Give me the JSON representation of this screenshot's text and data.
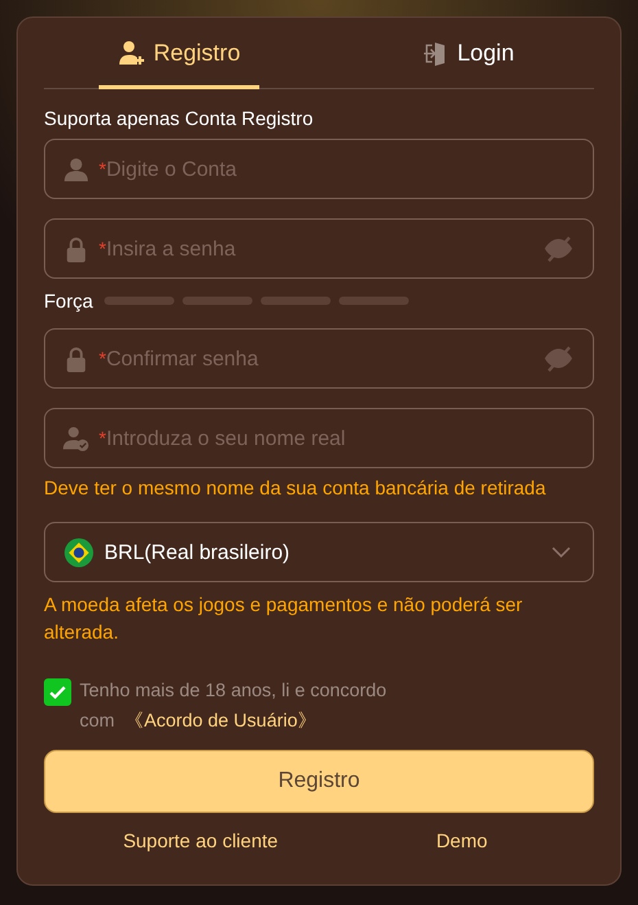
{
  "tabs": [
    {
      "label": "Registro",
      "selected": true
    },
    {
      "label": "Login",
      "selected": false
    }
  ],
  "heading": "Suporta apenas Conta Registro",
  "fields": [
    {
      "marker": "*",
      "placeholder": "Digite o Conta",
      "reveal": false
    },
    {
      "marker": "*",
      "placeholder": "Insira a senha",
      "reveal": true
    }
  ],
  "strength": {
    "label": "Força"
  },
  "fields_2": [
    {
      "marker": "*",
      "placeholder": "Confirmar senha",
      "reveal": true
    },
    {
      "marker": "*",
      "placeholder": "Introduza o seu nome real",
      "reveal": false
    }
  ],
  "name_hint": "Deve ter o mesmo nome da sua conta bancária de retirada",
  "currency": {
    "value": "BRL(Real brasileiro)"
  },
  "currency_hint": "A moeda afeta os jogos e pagamentos e não poderá ser alterada.",
  "agreement": {
    "checked": true,
    "text": "Tenho mais de 18 anos, li e concordo com",
    "link": "《Acordo de Usuário》"
  },
  "submit": "Registro",
  "footer_links": [
    "Suporte ao cliente",
    "Demo"
  ]
}
